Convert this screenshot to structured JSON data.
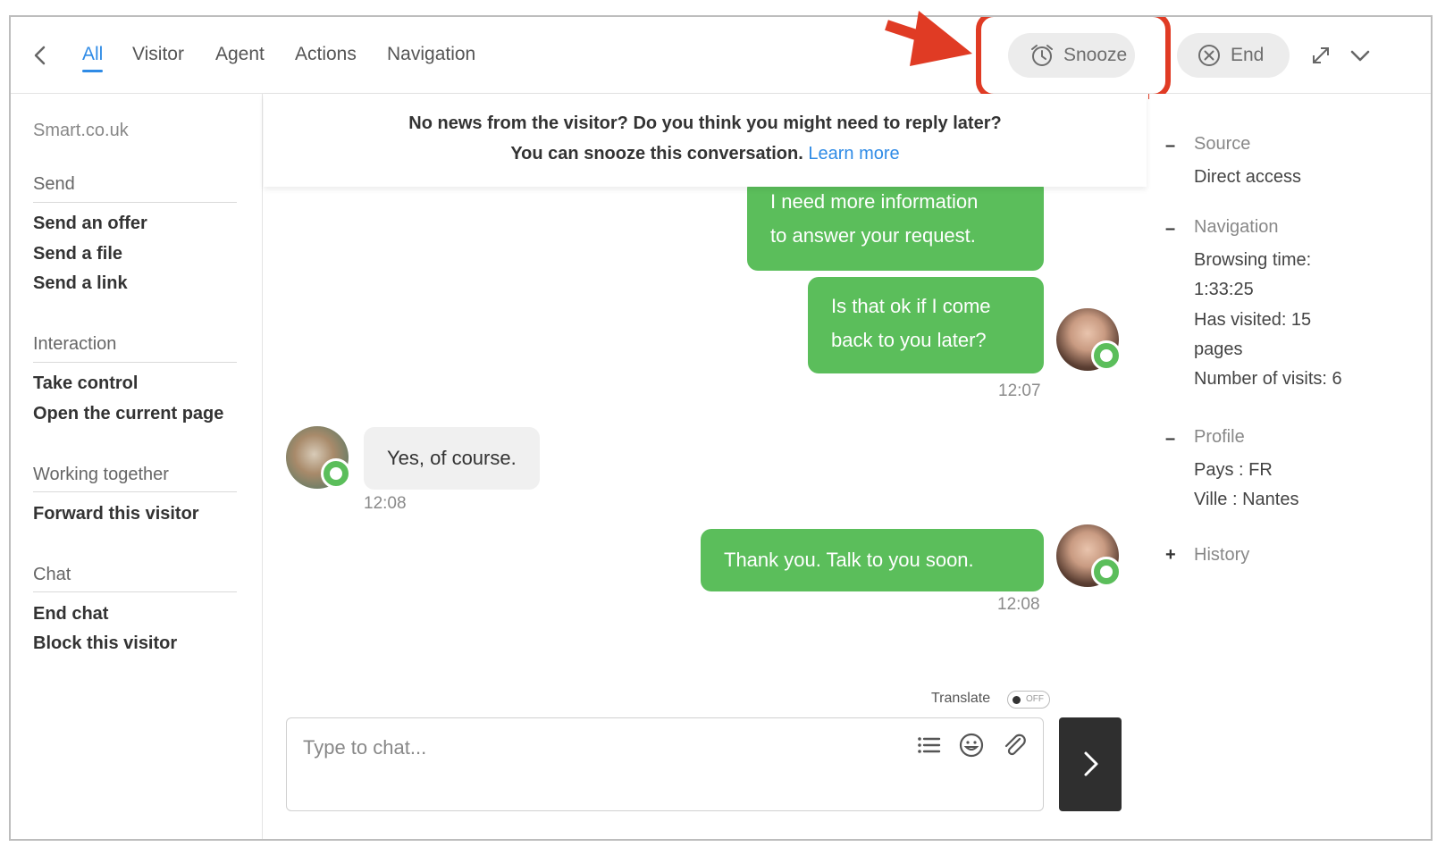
{
  "topbar": {
    "tabs": [
      "All",
      "Visitor",
      "Agent",
      "Actions",
      "Navigation"
    ],
    "snooze_label": "Snooze",
    "end_label": "End"
  },
  "sidebar": {
    "site": "Smart.co.uk",
    "sections": [
      {
        "title": "Send",
        "items": [
          "Send an offer",
          "Send a file",
          "Send a link"
        ]
      },
      {
        "title": "Interaction",
        "items": [
          "Take control",
          "Open the current page"
        ]
      },
      {
        "title": "Working together",
        "items": [
          "Forward this visitor"
        ]
      },
      {
        "title": "Chat",
        "items": [
          "End chat",
          "Block this visitor"
        ]
      }
    ]
  },
  "notice": {
    "line1": "No news from the visitor? Do you think you might need to reply later?",
    "line2": "You can snooze this conversation.",
    "link": "Learn more"
  },
  "messages": [
    {
      "from": "agent",
      "lines": [
        "I need more information",
        "to answer your request."
      ]
    },
    {
      "from": "agent",
      "lines": [
        "Is that ok if I come",
        "back to you later?"
      ],
      "time": "12:07"
    },
    {
      "from": "visitor",
      "lines": [
        "Yes, of course."
      ],
      "time": "12:08"
    },
    {
      "from": "agent",
      "lines": [
        "Thank you. Talk to you soon."
      ],
      "time": "12:08"
    }
  ],
  "composer": {
    "translate_label": "Translate",
    "translate_state": "OFF",
    "placeholder": "Type to chat..."
  },
  "info": {
    "source": {
      "title": "Source",
      "value": "Direct access"
    },
    "navigation": {
      "title": "Navigation",
      "lines": [
        "Browsing time:",
        "1:33:25",
        "Has visited: 15",
        "pages",
        "Number of visits: 6"
      ]
    },
    "profile": {
      "title": "Profile",
      "lines": [
        "Pays : FR",
        "Ville : Nantes"
      ]
    },
    "history": {
      "title": "History"
    }
  },
  "colors": {
    "accent": "#2f8be6",
    "agent_bubble": "#5bbe5b",
    "highlight": "#e03b24"
  },
  "icons": [
    "back-icon",
    "alarm-clock-icon",
    "close-circle-icon",
    "expand-icon",
    "chevron-down-icon",
    "list-icon",
    "emoji-icon",
    "paperclip-icon",
    "chevron-right-icon",
    "chat-bubble-icon"
  ]
}
